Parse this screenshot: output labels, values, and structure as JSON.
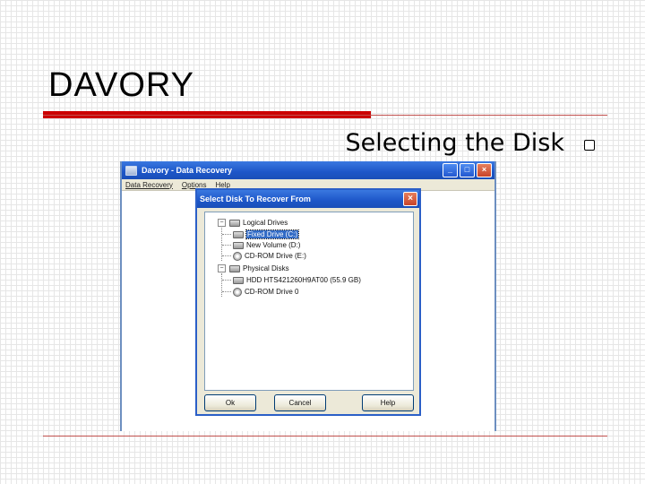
{
  "slide": {
    "title": "DAVORY",
    "bullet": "Selecting the Disk"
  },
  "app": {
    "title": "Davory - Data Recovery",
    "menu": [
      "Data Recovery",
      "Options",
      "Help"
    ],
    "controls": [
      "_",
      "□",
      "×"
    ]
  },
  "dialog": {
    "title": "Select Disk To Recover From",
    "close": "×",
    "tree": {
      "logical_drives": "Logical Drives",
      "fixed_drive": "Fixed Drive (C:)",
      "new_volume": "New Volume (D:)",
      "cdrom_drive": "CD-ROM Drive (E:)",
      "physical_disks": "Physical Disks",
      "hdd": "HDD HTS421260H9AT00 (55.9 GB)",
      "cdrom_unit": "CD-ROM Drive 0"
    },
    "buttons": {
      "ok": "Ok",
      "cancel": "Cancel",
      "help": "Help"
    }
  },
  "colors": {
    "accent_red": "#cc0000",
    "titlebar_blue": "#1d56c8",
    "selection_blue": "#316ac5"
  }
}
